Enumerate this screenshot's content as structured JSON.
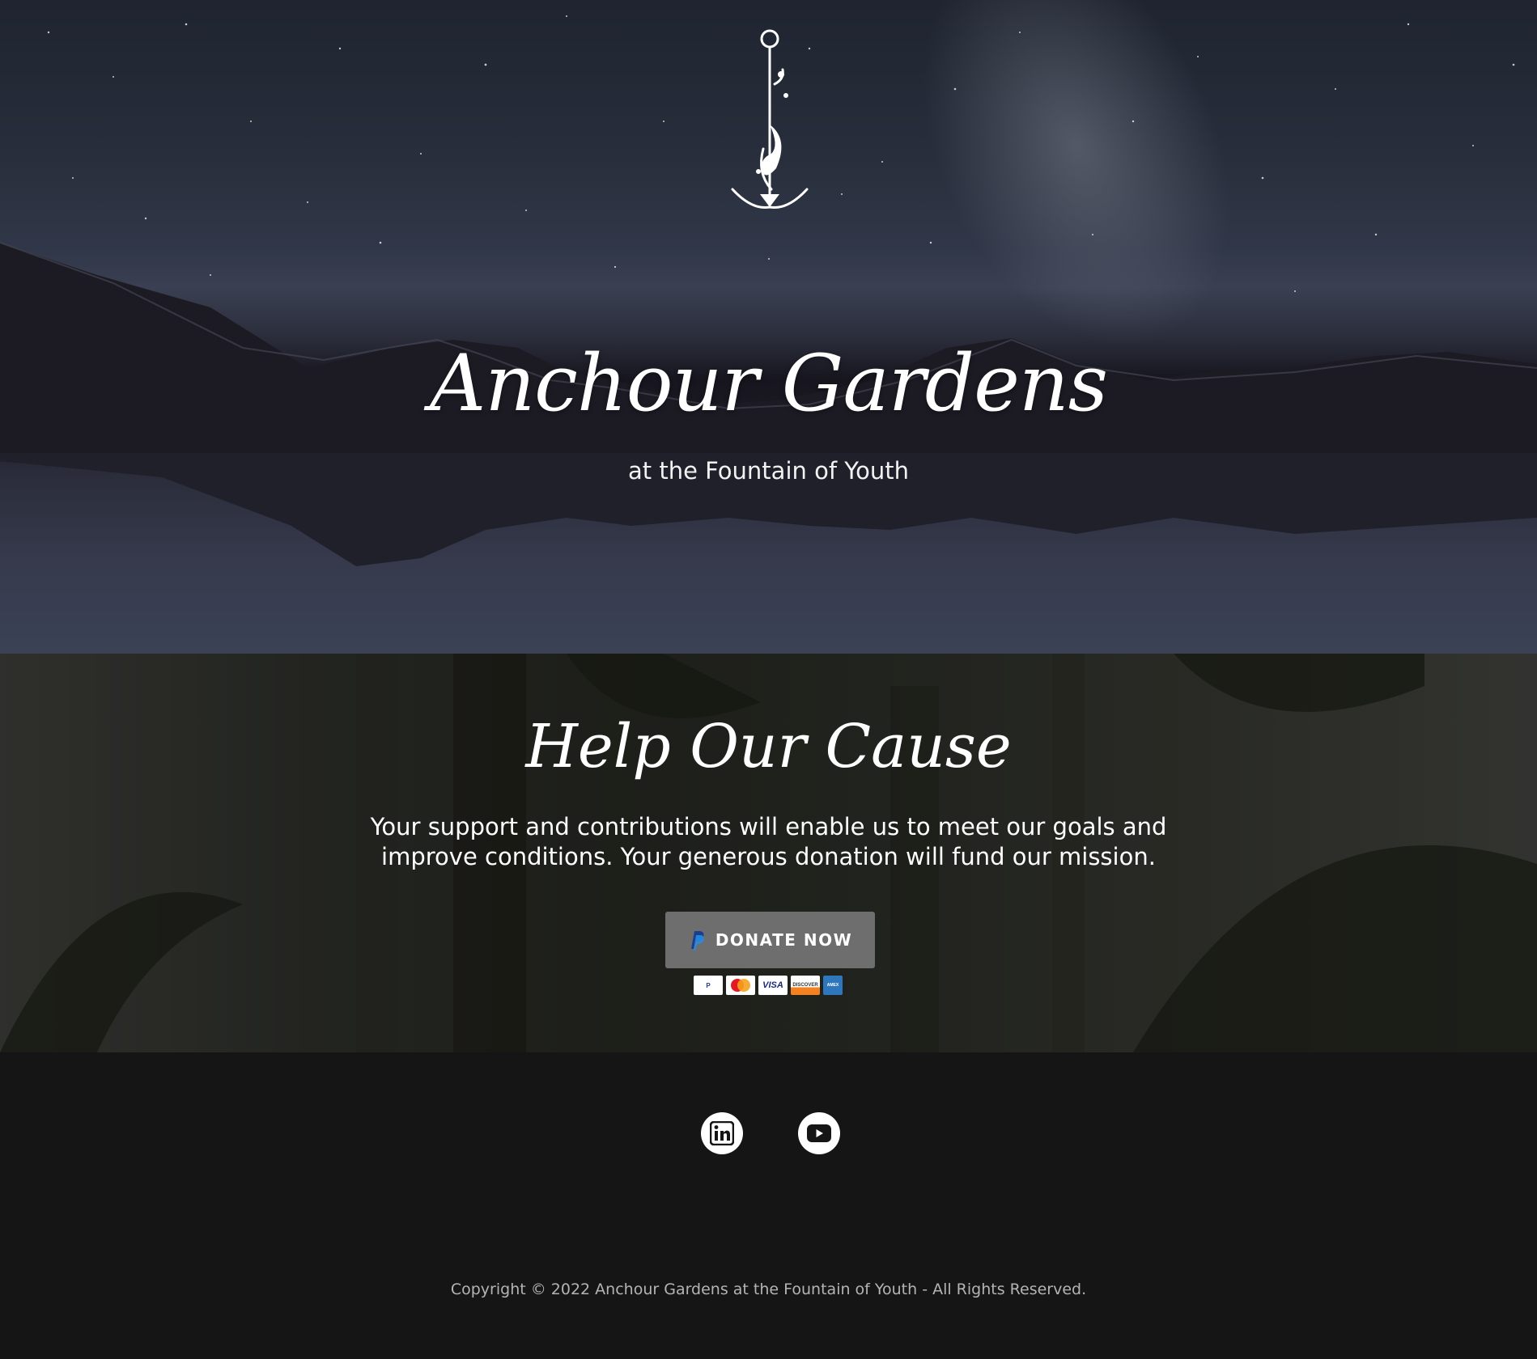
{
  "hero": {
    "title": "Anchour Gardens",
    "subtitle": "at the Fountain of Youth"
  },
  "donate": {
    "title": "Help Our Cause",
    "text": "Your support and contributions will enable us to meet our goals and improve conditions. Your generous donation will fund our mission.",
    "button_label": "DONATE NOW",
    "cards": [
      "PayPal",
      "MasterCard",
      "VISA",
      "DISCOVER",
      "AMERICAN EXPRESS"
    ]
  },
  "footer": {
    "social": [
      "linkedin-icon",
      "youtube-icon"
    ],
    "copyright": "Copyright © 2022 Anchour Gardens at the Fountain of Youth - All Rights Reserved."
  },
  "colors": {
    "footer_bg": "#151516",
    "button_bg": "#6e6e6e",
    "text": "#ffffff"
  }
}
